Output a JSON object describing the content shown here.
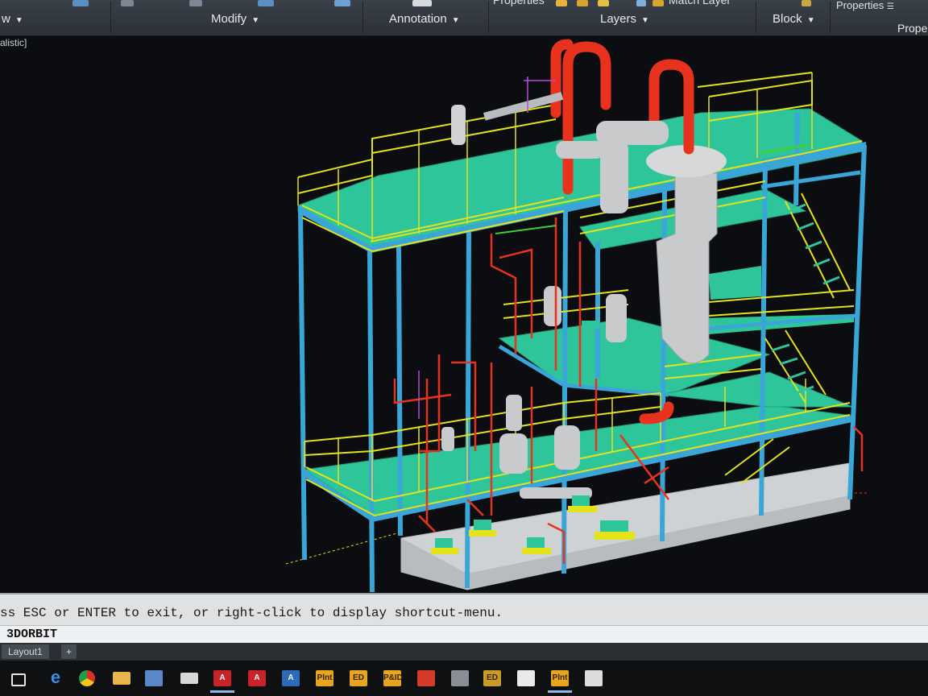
{
  "ribbon": {
    "left_partial": "w",
    "modify_label": "Modify",
    "annotation_label": "Annotation",
    "layers_label": "Layers",
    "block_label": "Block",
    "properties_top": "Properties",
    "properties_right": "Proper",
    "properties_small": "Properties",
    "match_layer": "Match Layer"
  },
  "viewport": {
    "visual_style_label": "alistic]"
  },
  "command": {
    "history_text": "ss ESC or ENTER to exit, or right-click to display shortcut-menu.",
    "current_command": "3DORBIT"
  },
  "layout_tabs": {
    "tab1": "Layout1",
    "add_tab": "+"
  },
  "taskbar": {
    "icons": [
      "task-view",
      "edge",
      "chrome",
      "file-explorer",
      "store",
      "mail",
      "autocad-a",
      "autocad-b",
      "autocad-c",
      "plant3d",
      "autocad-ed",
      "pid",
      "recorder",
      "calculator",
      "ed-app",
      "clapper",
      "plant3d-active",
      "photos"
    ],
    "labels": {
      "plant": "Plnt",
      "ed": "ED",
      "pid": "P&ID"
    }
  },
  "colors": {
    "ribbon_bg": "#2c3137",
    "viewport_bg": "#0b0d10",
    "steel_blue": "#3aa6d8",
    "platform_green": "#2fc59b",
    "railing_yellow": "#e4e21a",
    "pipe_red": "#e8321e",
    "equipment_gray": "#c8cacc",
    "command_bg": "#dfe1e3"
  }
}
